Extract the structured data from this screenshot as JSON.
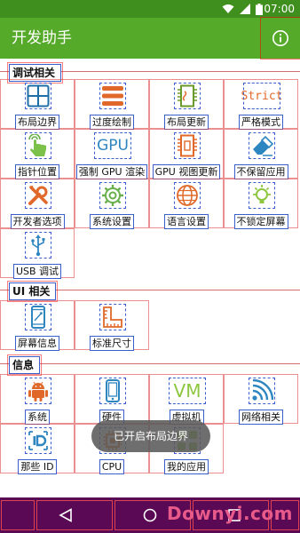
{
  "status": {
    "time": "07:00"
  },
  "app": {
    "title": "开发助手"
  },
  "sections": [
    {
      "title": "调试相关"
    },
    {
      "title": "UI 相关"
    },
    {
      "title": "信息"
    }
  ],
  "debug_items": [
    {
      "label": "布局边界",
      "icon": "layout-icon"
    },
    {
      "label": "过度绘制",
      "icon": "menu-lines-icon"
    },
    {
      "label": "布局更新",
      "icon": "layout-update-icon"
    },
    {
      "label": "严格模式",
      "icon_text": "Strict",
      "icon": "strict-icon"
    },
    {
      "label": "指针位置",
      "icon": "pointer-icon"
    },
    {
      "label": "强制 GPU 渲染",
      "icon_text": "GPU",
      "icon": "gpu-icon"
    },
    {
      "label": "GPU 视图更新",
      "icon": "gpu-view-icon"
    },
    {
      "label": "不保留应用",
      "icon": "eraser-icon"
    },
    {
      "label": "开发者选项",
      "icon": "tools-icon"
    },
    {
      "label": "系统设置",
      "icon": "gear-icon"
    },
    {
      "label": "语言设置",
      "icon": "globe-icon"
    },
    {
      "label": "不锁定屏幕",
      "icon": "bulb-icon"
    },
    {
      "label": "USB 调试",
      "icon": "usb-icon"
    }
  ],
  "ui_items": [
    {
      "label": "屏幕信息",
      "icon": "phone-icon"
    },
    {
      "label": "标准尺寸",
      "icon": "ruler-icon"
    }
  ],
  "info_items": [
    {
      "label": "系统",
      "icon": "android-icon"
    },
    {
      "label": "硬件",
      "icon": "device-icon"
    },
    {
      "label": "虚拟机",
      "icon_text": "VM",
      "icon": "vm-icon"
    },
    {
      "label": "网络相关",
      "icon": "wifi-icon"
    },
    {
      "label": "那些 ID",
      "icon": "id-icon"
    },
    {
      "label": "CPU",
      "icon": "cpu-icon"
    },
    {
      "label": "我的应用",
      "icon": "apps-icon"
    }
  ],
  "toast": {
    "text": "已开启布局边界"
  },
  "watermark": {
    "text": "Downyi.com"
  },
  "colors": {
    "primary": "#55aa2a",
    "status": "#3f8f1f",
    "accent": "#e0692a",
    "nav": "#5a0a55"
  }
}
